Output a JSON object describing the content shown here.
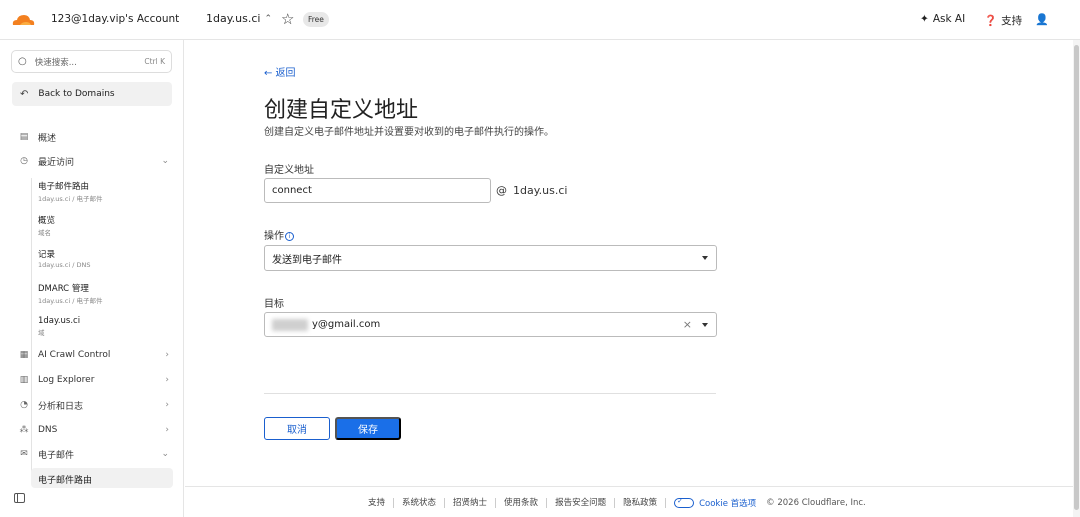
{
  "topbar": {
    "account": "123@1day.vip's Account",
    "domain": "1day.us.ci",
    "plan_badge": "Free",
    "ask_ai": "Ask AI",
    "support": "支持"
  },
  "sidebar": {
    "search_placeholder": "快速搜索...",
    "search_shortcut": "Ctrl K",
    "back_to_domains": "Back to Domains",
    "items": [
      {
        "label": "概述",
        "icon": "document-icon"
      },
      {
        "label": "最近访问",
        "icon": "clock-icon"
      },
      {
        "label": "AI Crawl Control",
        "icon": "robot-icon"
      },
      {
        "label": "Log Explorer",
        "icon": "log-icon"
      },
      {
        "label": "分析和日志",
        "icon": "chart-icon"
      },
      {
        "label": "DNS",
        "icon": "dns-icon"
      },
      {
        "label": "电子邮件",
        "icon": "email-icon"
      }
    ],
    "recent": [
      {
        "title": "电子邮件路由",
        "sub": "1day.us.ci  /  电子邮件"
      },
      {
        "title": "概览",
        "sub": "域名"
      },
      {
        "title": "记录",
        "sub": "1day.us.ci  /  DNS"
      },
      {
        "title": "DMARC 管理",
        "sub": "1day.us.ci  /  电子邮件"
      },
      {
        "title": "1day.us.ci",
        "sub": "域"
      }
    ],
    "active_sub": "电子邮件路由"
  },
  "main": {
    "back": "← 返回",
    "title": "创建自定义地址",
    "description": "创建自定义电子邮件地址并设置要对收到的电子邮件执行的操作。",
    "custom_address_label": "自定义地址",
    "custom_address_value": "connect",
    "at_symbol": "@",
    "domain_suffix": "1day.us.ci",
    "action_label": "操作",
    "action_value": "发送到电子邮件",
    "target_label": "目标",
    "target_value": "y@gmail.com",
    "cancel": "取消",
    "save": "保存"
  },
  "footer": {
    "links": [
      "支持",
      "系统状态",
      "招贤纳士",
      "使用条款",
      "报告安全问题",
      "隐私政策"
    ],
    "cookie": "Cookie 首选项",
    "copyright": "© 2026 Cloudflare, Inc."
  },
  "colors": {
    "accent": "#1a6fe8",
    "link": "#1a5fce",
    "brand_orange": "#f38020"
  }
}
